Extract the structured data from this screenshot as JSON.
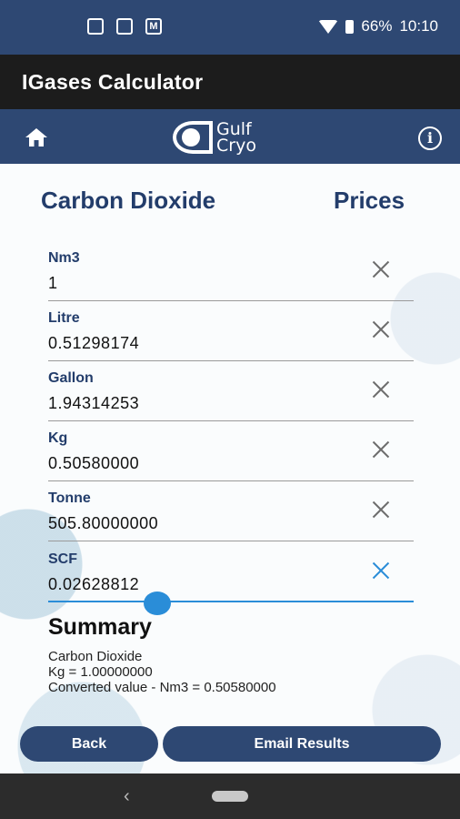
{
  "status_bar": {
    "notification_icons": [
      "image-icon",
      "app-icon",
      "gmail-icon"
    ],
    "battery": "66%",
    "time": "10:10"
  },
  "app_title": "IGases Calculator",
  "logo": {
    "line1": "Gulf",
    "line2": "Cryo"
  },
  "gas_name": "Carbon Dioxide",
  "prices_link": "Prices",
  "fields": [
    {
      "label": "Nm3",
      "value": "1"
    },
    {
      "label": "Litre",
      "value": "0.51298174"
    },
    {
      "label": "Gallon",
      "value": "1.94314253"
    },
    {
      "label": "Kg",
      "value": "0.50580000"
    },
    {
      "label": "Tonne",
      "value": "505.80000000"
    },
    {
      "label": "SCF",
      "value": "0.02628812"
    }
  ],
  "summary": {
    "title": "Summary",
    "lines": [
      "Carbon Dioxide",
      "Kg = 1.00000000",
      "Converted value - Nm3 = 0.50580000"
    ]
  },
  "buttons": {
    "back": "Back",
    "email": "Email Results"
  },
  "colors": {
    "primary": "#2e4873",
    "accent": "#2a8dd8",
    "heading": "#233d6b"
  }
}
